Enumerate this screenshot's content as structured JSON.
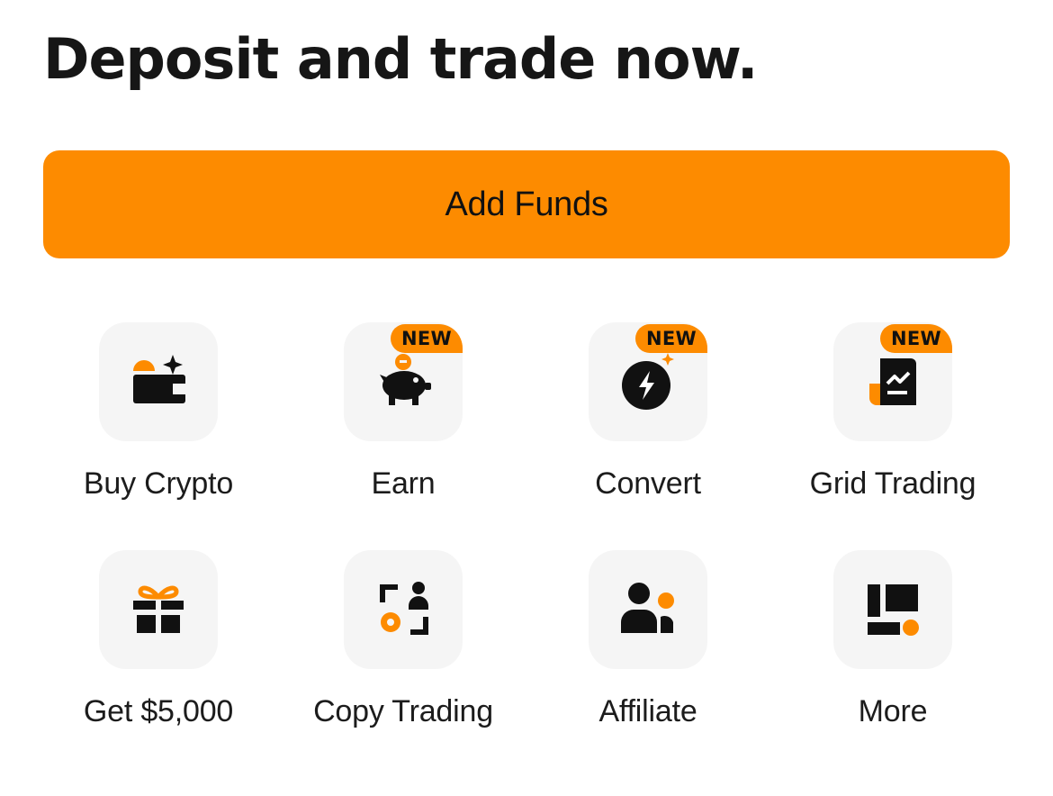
{
  "header": {
    "title": "Deposit and trade now."
  },
  "cta": {
    "label": "Add Funds",
    "color": "#fd8b00"
  },
  "colors": {
    "accent": "#fd8b00",
    "icon_dark": "#111111",
    "tile_bg": "#f5f5f5"
  },
  "tiles": [
    {
      "label": "Buy Crypto",
      "icon": "wallet-sparkle-icon",
      "badge": ""
    },
    {
      "label": "Earn",
      "icon": "piggy-bank-icon",
      "badge": "NEW"
    },
    {
      "label": "Convert",
      "icon": "lightning-convert-icon",
      "badge": "NEW"
    },
    {
      "label": "Grid Trading",
      "icon": "grid-trading-chart-icon",
      "badge": "NEW"
    },
    {
      "label": "Get $5,000",
      "icon": "gift-icon",
      "badge": ""
    },
    {
      "label": "Copy Trading",
      "icon": "copy-trading-icon",
      "badge": ""
    },
    {
      "label": "Affiliate",
      "icon": "affiliate-people-icon",
      "badge": ""
    },
    {
      "label": "More",
      "icon": "more-grid-icon",
      "badge": ""
    }
  ]
}
